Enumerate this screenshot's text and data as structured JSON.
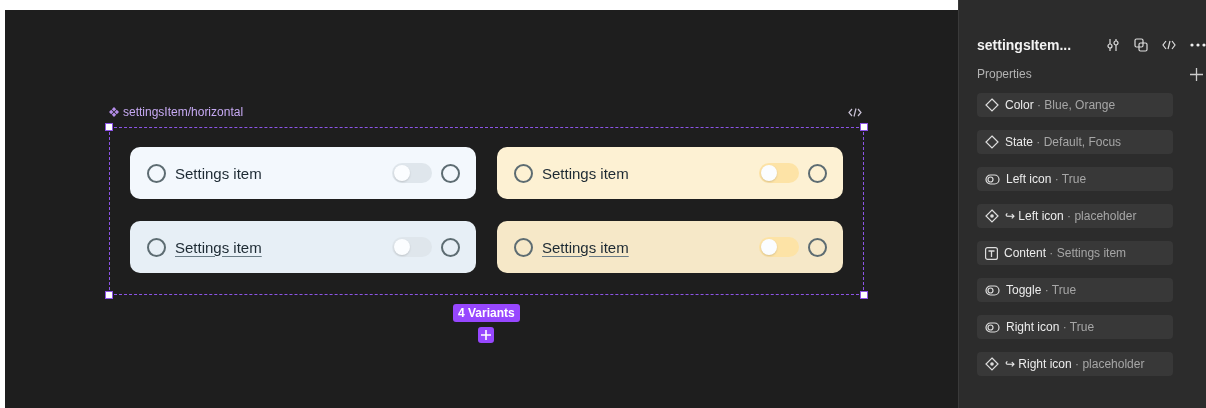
{
  "canvas": {
    "frame_label": "settingsItem/horizontal",
    "variants": [
      {
        "kind": "blue",
        "focused": false,
        "label": "Settings item"
      },
      {
        "kind": "orange",
        "focused": false,
        "label": "Settings item"
      },
      {
        "kind": "blue",
        "focused": true,
        "label": "Settings item"
      },
      {
        "kind": "orange",
        "focused": true,
        "label": "Settings item"
      }
    ],
    "variants_badge": "4 Variants"
  },
  "panel": {
    "title": "settingsItem...",
    "section": "Properties",
    "separator": "·",
    "properties": [
      {
        "kind": "variant",
        "name": "Color",
        "value": "Blue, Orange"
      },
      {
        "kind": "variant",
        "name": "State",
        "value": "Default, Focus"
      },
      {
        "kind": "boolean",
        "name": "Left icon",
        "value": "True"
      },
      {
        "kind": "swap",
        "name": "↪ Left icon",
        "value": "placeholder"
      },
      {
        "kind": "text",
        "name": "Content",
        "value": "Settings item"
      },
      {
        "kind": "boolean",
        "name": "Toggle",
        "value": "True"
      },
      {
        "kind": "boolean",
        "name": "Right icon",
        "value": "True"
      },
      {
        "kind": "swap",
        "name": "↪ Right icon",
        "value": "placeholder"
      }
    ]
  }
}
